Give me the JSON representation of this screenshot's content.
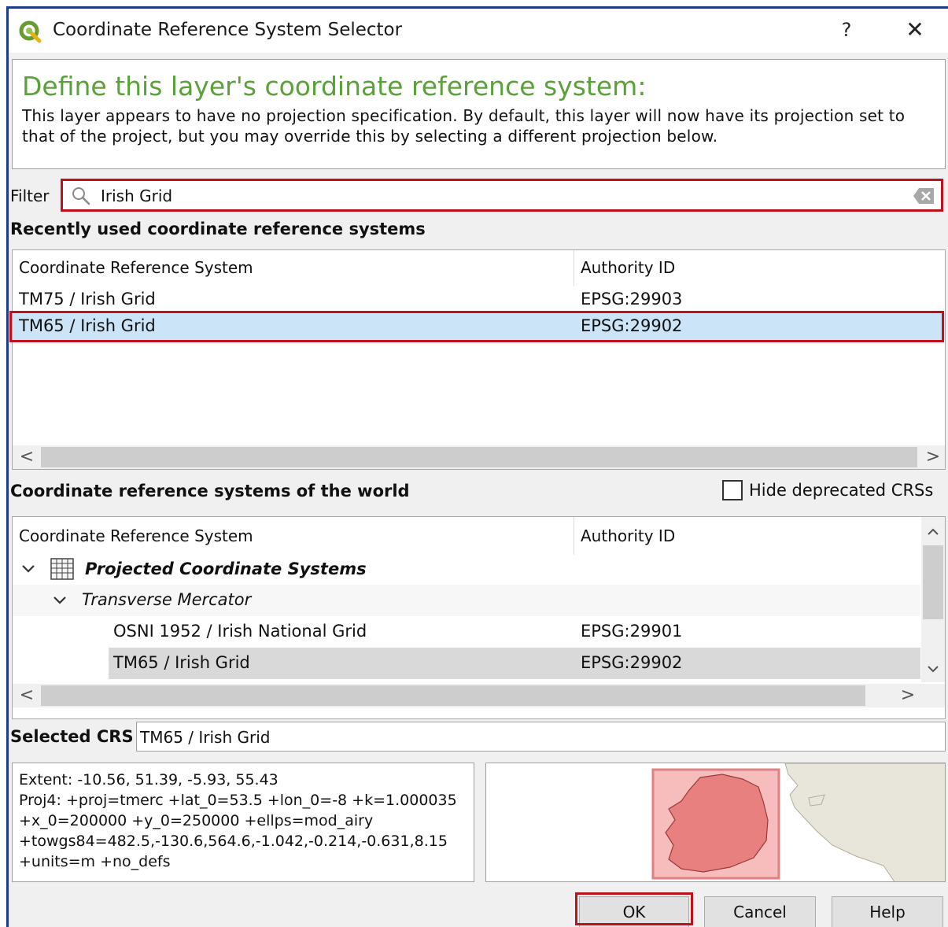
{
  "window": {
    "title": "Coordinate Reference System Selector",
    "help_label": "?",
    "close_label": "✕"
  },
  "info": {
    "title": "Define this layer's coordinate reference system:",
    "description": "This layer appears to have no projection specification. By default, this layer will now have its projection set to that of the project, but you may override this by selecting a different projection below."
  },
  "filter": {
    "label": "Filter",
    "value": "Irish Grid"
  },
  "recent": {
    "heading": "Recently used coordinate reference systems",
    "columns": [
      "Coordinate Reference System",
      "Authority ID"
    ],
    "rows": [
      {
        "name": "TM75 / Irish Grid",
        "id": "EPSG:29903"
      },
      {
        "name": "TM65 / Irish Grid",
        "id": "EPSG:29902"
      }
    ],
    "selected_index": 1,
    "scroll_left": "<",
    "scroll_right": ">"
  },
  "world": {
    "heading": "Coordinate reference systems of the world",
    "hide_deprecated_label": "Hide deprecated CRSs",
    "hide_deprecated_checked": false,
    "columns": [
      "Coordinate Reference System",
      "Authority ID"
    ],
    "group": "Projected Coordinate Systems",
    "subgroup": "Transverse Mercator",
    "rows": [
      {
        "name": "OSNI 1952 / Irish National Grid",
        "id": "EPSG:29901"
      },
      {
        "name": "TM65 / Irish Grid",
        "id": "EPSG:29902"
      }
    ],
    "selected_index": 1,
    "scroll_left": "<",
    "scroll_right": ">",
    "scroll_up": "^",
    "scroll_down": "v"
  },
  "selected_crs": {
    "label": "Selected CRS",
    "value": "TM65 / Irish Grid"
  },
  "projection": {
    "lines": [
      "Extent: -10.56, 51.39, -5.93, 55.43",
      "Proj4: +proj=tmerc +lat_0=53.5 +lon_0=-8 +k=1.000035",
      "+x_0=200000 +y_0=250000 +ellps=mod_airy",
      "+towgs84=482.5,-130.6,564.6,-1.042,-0.214,-0.631,8.15",
      "+units=m +no_defs"
    ]
  },
  "buttons": {
    "ok": "OK",
    "cancel": "Cancel",
    "help": "Help"
  },
  "colors": {
    "accent_title": "#5aa13a",
    "highlight_outline": "#c0101a",
    "selection": "#cce4f7",
    "extent_fill": "#f08080"
  }
}
